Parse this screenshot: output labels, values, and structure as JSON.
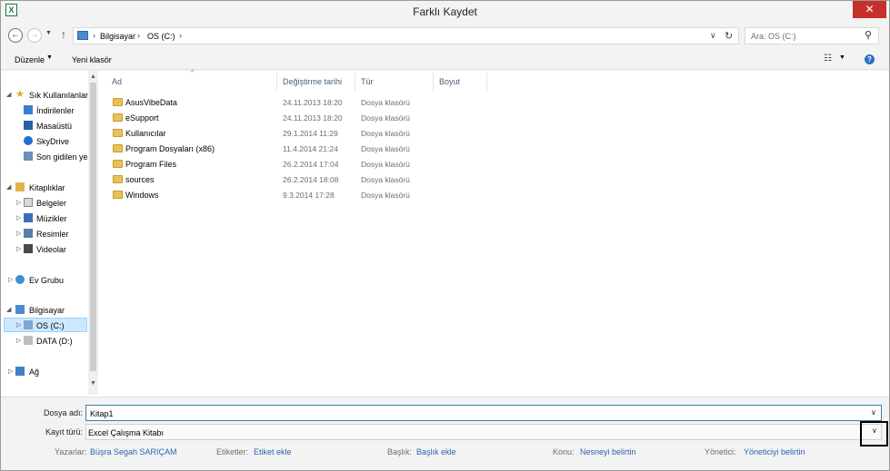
{
  "window": {
    "title": "Farklı Kaydet",
    "app_icon_letter": "X",
    "close_glyph": "✕"
  },
  "address_bar": {
    "segments": [
      "Bilgisayar",
      "OS (C:)"
    ],
    "separator": "›"
  },
  "search": {
    "placeholder": "Ara: OS (C:)"
  },
  "toolbar": {
    "organize_label": "Düzenle",
    "new_folder_label": "Yeni klasör"
  },
  "nav_pane": {
    "favorites": {
      "label": "Sık Kullanılanlar",
      "items": [
        "İndirilenler",
        "Masaüstü",
        "SkyDrive",
        "Son gidilen yer"
      ]
    },
    "libraries": {
      "label": "Kitaplıklar",
      "items": [
        "Belgeler",
        "Müzikler",
        "Resimler",
        "Videolar"
      ]
    },
    "homegroup": {
      "label": "Ev Grubu"
    },
    "computer": {
      "label": "Bilgisayar",
      "items": [
        "OS (C:)",
        "DATA (D:)"
      ]
    },
    "network": {
      "label": "Ağ"
    }
  },
  "file_list": {
    "columns": [
      "Ad",
      "Değiştirme tarihi",
      "Tür",
      "Boyut"
    ],
    "rows": [
      {
        "name": "AsusVibeData",
        "date": "24.11.2013 18:20",
        "type": "Dosya klasörü"
      },
      {
        "name": "eSupport",
        "date": "24.11.2013 18:20",
        "type": "Dosya klasörü"
      },
      {
        "name": "Kullanıcılar",
        "date": "29.1.2014 11:29",
        "type": "Dosya klasörü"
      },
      {
        "name": "Program Dosyaları (x86)",
        "date": "11.4.2014 21:24",
        "type": "Dosya klasörü"
      },
      {
        "name": "Program Files",
        "date": "26.2.2014 17:04",
        "type": "Dosya klasörü"
      },
      {
        "name": "sources",
        "date": "26.2.2014 18:08",
        "type": "Dosya klasörü"
      },
      {
        "name": "Windows",
        "date": "9.3.2014 17:28",
        "type": "Dosya klasörü"
      }
    ]
  },
  "save_form": {
    "filename_label": "Dosya adı:",
    "filename_value": "Kitap1",
    "filetype_label": "Kayıt türü:",
    "filetype_value": "Excel Çalışma Kitabı",
    "metadata": [
      {
        "label": "Yazarlar:",
        "value": "Büşra Segah SARIÇAM"
      },
      {
        "label": "Etiketler:",
        "value": "Etiket ekle"
      },
      {
        "label": "Başlık:",
        "value": "Başlık ekle"
      },
      {
        "label": "Konu:",
        "value": "Nesneyi belirtin"
      },
      {
        "label": "Yönetici:",
        "value": "Yöneticiyi belirtin"
      }
    ]
  }
}
